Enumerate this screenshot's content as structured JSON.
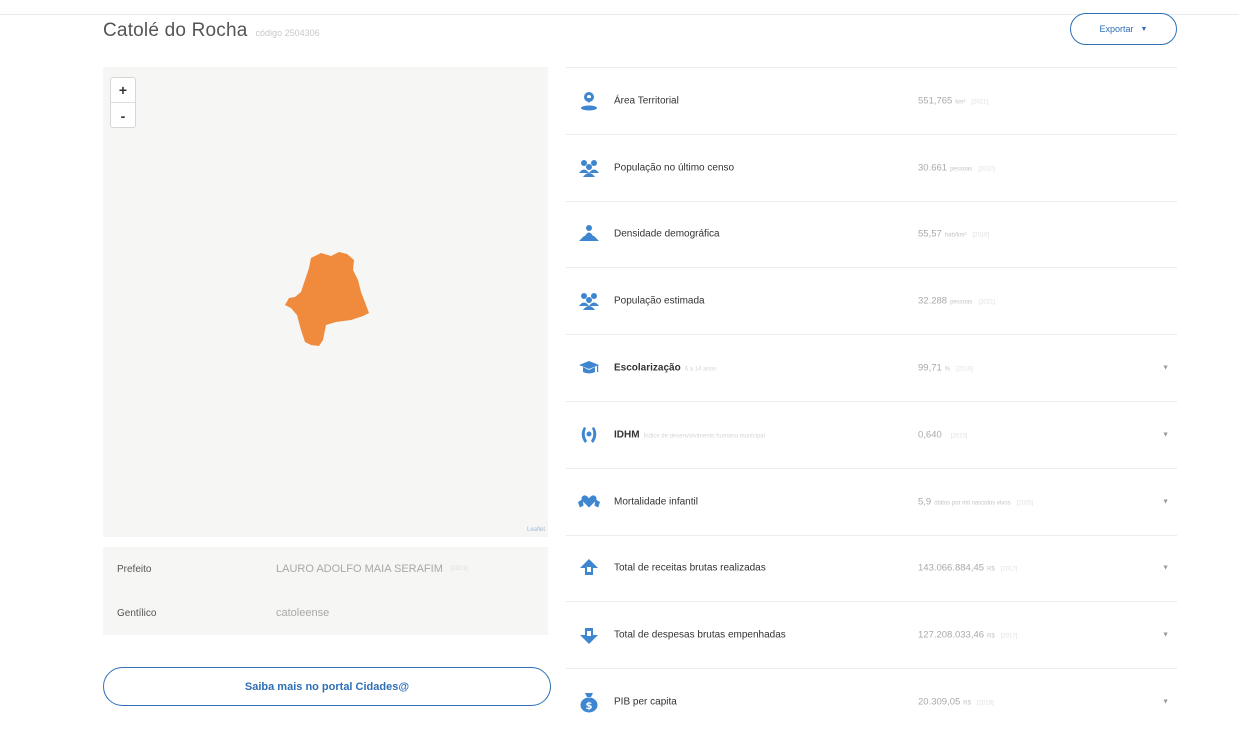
{
  "header": {
    "city_name": "Catolé do Rocha",
    "city_code": "código 2504306",
    "export_label": "Exportar"
  },
  "map": {
    "zoom_in": "+",
    "zoom_out": "-",
    "attribution": "Leaflet",
    "region_color": "#f08a3c"
  },
  "info": [
    {
      "label": "Prefeito",
      "value": "LAURO ADOLFO MAIA SERAFIM",
      "note": "[2021]"
    },
    {
      "label": "Gentílico",
      "value": "catoleense",
      "note": ""
    }
  ],
  "portal_button": "Saiba mais no portal Cidades@",
  "indicators": [
    {
      "icon": "map-pin-icon",
      "label": "Área Territorial",
      "sub": "",
      "value": "551,765",
      "unit": "km²",
      "note": "[2021]",
      "expandable": false
    },
    {
      "icon": "people-icon",
      "label": "População no último censo",
      "sub": "",
      "value": "30.661",
      "unit": "pessoas",
      "note": "[2010]",
      "expandable": false
    },
    {
      "icon": "person-map-icon",
      "label": "Densidade demográfica",
      "sub": "",
      "value": "55,57",
      "unit": "hab/km²",
      "note": "[2010]",
      "expandable": false
    },
    {
      "icon": "people-icon",
      "label": "População estimada",
      "sub": "",
      "value": "32.288",
      "unit": "pessoas",
      "note": "[2021]",
      "expandable": false
    },
    {
      "icon": "graduation-cap-icon",
      "label": "Escolarização",
      "sub": "6 a 14 anos",
      "value": "99,71",
      "unit": "%",
      "note": "[2010]",
      "expandable": true
    },
    {
      "icon": "laurel-icon",
      "label": "IDHM",
      "sub": "Índice de desenvolvimento humano municipal",
      "value": "0,640",
      "unit": "",
      "note": "[2010]",
      "expandable": true
    },
    {
      "icon": "heart-hands-icon",
      "label": "Mortalidade infantil",
      "sub": "",
      "value": "5,9",
      "unit": "óbitos por mil nascidos vivos",
      "note": "[2020]",
      "expandable": true
    },
    {
      "icon": "arrow-up-icon",
      "label": "Total de receitas brutas realizadas",
      "sub": "",
      "value": "143.066.884,45",
      "unit": "R$",
      "note": "[2017]",
      "expandable": true
    },
    {
      "icon": "arrow-down-icon",
      "label": "Total de despesas brutas empenhadas",
      "sub": "",
      "value": "127.208.033,46",
      "unit": "R$",
      "note": "[2017]",
      "expandable": true
    },
    {
      "icon": "money-bag-icon",
      "label": "PIB per capita",
      "sub": "",
      "value": "20.309,05",
      "unit": "R$",
      "note": "[2019]",
      "expandable": true
    }
  ],
  "colors": {
    "accent": "#2e6fb7",
    "icon_blue": "#3f86d1",
    "map_bg": "#f6f6f4"
  }
}
